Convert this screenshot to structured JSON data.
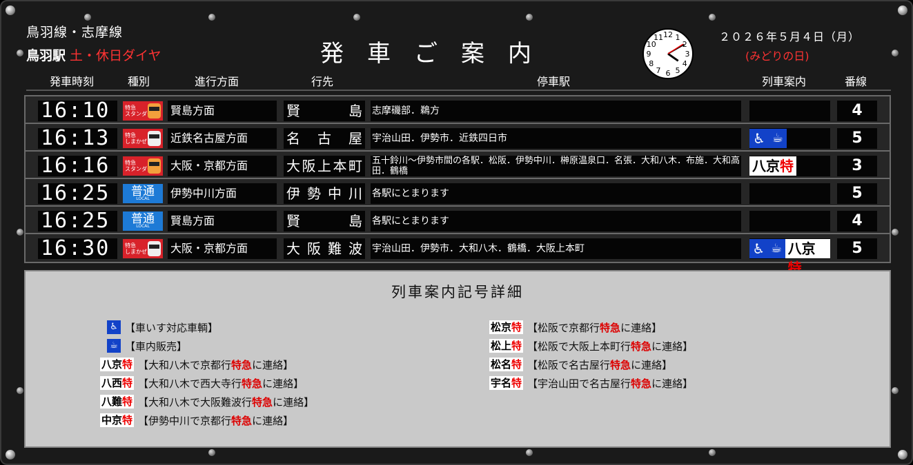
{
  "header": {
    "line_name": "鳥羽線・志摩線",
    "station": "鳥羽駅",
    "schedule_type": "土・休日ダイヤ",
    "title": "発車ご案内",
    "date": "２０２６年５月４日（月）",
    "holiday": "(みどりの日)"
  },
  "clock": {
    "hour": 4,
    "minute": 10
  },
  "columns": {
    "time": "発車時刻",
    "type": "種別",
    "direction": "進行方面",
    "destination": "行先",
    "stops": "停車駅",
    "info": "列車案内",
    "track": "番線"
  },
  "departures": [
    {
      "time": "16:10",
      "type": "特急 スタンダード",
      "type_kind": "ltd-stand",
      "direction": "賢島方面",
      "destination": "賢島",
      "stops": "志摩磯部．鵜方",
      "info": [],
      "track": "4"
    },
    {
      "time": "16:13",
      "type": "特急 しまかぜ",
      "type_kind": "ltd",
      "direction": "近鉄名古屋方面",
      "destination": "名古屋",
      "stops": "宇治山田．伊勢市．近鉄四日市",
      "info": [
        "wheelchair",
        "shop"
      ],
      "track": "5"
    },
    {
      "time": "16:16",
      "type": "特急 スタンダード",
      "type_kind": "ltd-stand",
      "direction": "大阪・京都方面",
      "destination": "大阪上本町",
      "stops": "五十鈴川～伊勢市間の各駅．松阪．伊勢中川．榊原温泉口．名張．大和八木．布施．大和高田．鶴橋",
      "info": [
        "八京特"
      ],
      "track": "3"
    },
    {
      "time": "16:25",
      "type": "普通",
      "type_kind": "local",
      "direction": "伊勢中川方面",
      "destination": "伊勢中川",
      "stops": "各駅にとまります",
      "info": [],
      "track": "5"
    },
    {
      "time": "16:25",
      "type": "普通",
      "type_kind": "local",
      "direction": "賢島方面",
      "destination": "賢島",
      "stops": "各駅にとまります",
      "info": [],
      "track": "4"
    },
    {
      "time": "16:30",
      "type": "特急 しまかぜ",
      "type_kind": "ltd",
      "direction": "大阪・京都方面",
      "destination": "大阪難波",
      "stops": "宇治山田．伊勢市．大和八木．鶴橋．大阪上本町",
      "info": [
        "wheelchair",
        "shop",
        "八京特"
      ],
      "track": "5"
    }
  ],
  "type_text": {
    "ltd": "特急",
    "ltd_sub_stand": "スタンダード",
    "ltd_sub_shima": "しまかぜ",
    "local": "普通",
    "local_sub": "LOCAL"
  },
  "legend": {
    "title": "列車案内記号詳細",
    "left": [
      {
        "sym": "wheelchair",
        "text": "【車いす対応車輌】"
      },
      {
        "sym": "shop",
        "text": "【車内販売】"
      },
      {
        "sym": "八京特",
        "pre": "【大和八木で京都行",
        "red": "特急",
        "post": "に連絡】"
      },
      {
        "sym": "八西特",
        "pre": "【大和八木で西大寺行",
        "red": "特急",
        "post": "に連絡】"
      },
      {
        "sym": "八難特",
        "pre": "【大和八木で大阪難波行",
        "red": "特急",
        "post": "に連絡】"
      },
      {
        "sym": "中京特",
        "pre": "【伊勢中川で京都行",
        "red": "特急",
        "post": "に連絡】"
      }
    ],
    "right": [
      {
        "sym": "松京特",
        "pre": "【松阪で京都行",
        "red": "特急",
        "post": "に連絡】"
      },
      {
        "sym": "松上特",
        "pre": "【松阪で大阪上本町行",
        "red": "特急",
        "post": "に連絡】"
      },
      {
        "sym": "松名特",
        "pre": "【松阪で名古屋行",
        "red": "特急",
        "post": "に連絡】"
      },
      {
        "sym": "宇名特",
        "pre": "【宇治山田で名古屋行",
        "red": "特急",
        "post": "に連絡】"
      }
    ]
  },
  "icons": {
    "wheelchair": "wheelchair-icon",
    "shop": "cup-icon"
  },
  "colors": {
    "red": "#ff3333",
    "local_blue": "#1d7ad6",
    "ltd_red": "#d8222a",
    "symbol_blue": "#1242c8"
  }
}
